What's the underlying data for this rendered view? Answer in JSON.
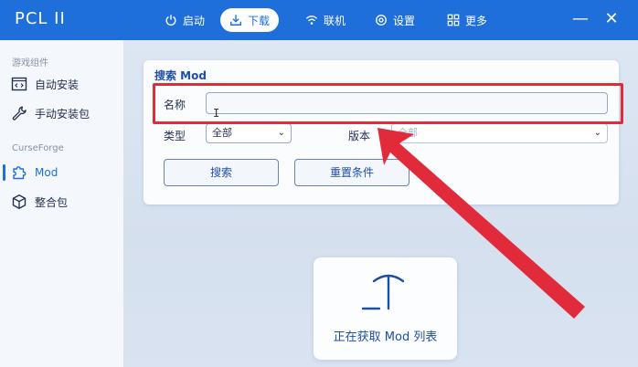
{
  "app": {
    "title": "PCL II"
  },
  "nav": {
    "items": [
      {
        "label": "启动",
        "icon": "power-icon"
      },
      {
        "label": "下载",
        "icon": "download-icon",
        "active": true
      },
      {
        "label": "联机",
        "icon": "wifi-icon"
      },
      {
        "label": "设置",
        "icon": "settings-icon"
      },
      {
        "label": "更多",
        "icon": "grid-icon"
      }
    ]
  },
  "window_controls": {
    "minimize": "—",
    "close": "✕"
  },
  "sidebar": {
    "sections": [
      {
        "header": "游戏组件",
        "items": [
          {
            "label": "自动安装",
            "icon": "code-window-icon"
          },
          {
            "label": "手动安装包",
            "icon": "wrench-icon"
          }
        ]
      },
      {
        "header": "CurseForge",
        "items": [
          {
            "label": "Mod",
            "icon": "puzzle-icon",
            "active": true
          },
          {
            "label": "整合包",
            "icon": "cube-icon"
          }
        ]
      }
    ]
  },
  "search_card": {
    "title": "搜索 Mod",
    "name_label": "名称",
    "name_value": "",
    "type_label": "类型",
    "type_value": "全部",
    "version_label": "版本",
    "version_value": "全部",
    "search_button": "搜索",
    "reset_button": "重置条件"
  },
  "loading": {
    "text": "正在获取 Mod 列表"
  },
  "colors": {
    "accent": "#1e6fd9",
    "annotation": "#e12b3a"
  }
}
